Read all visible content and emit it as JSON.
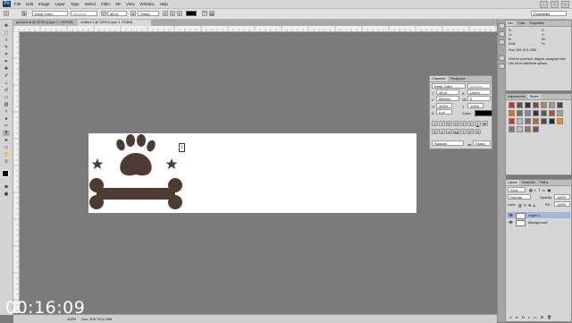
{
  "app": {
    "logo": "Ps"
  },
  "menu": [
    "File",
    "Edit",
    "Image",
    "Layer",
    "Type",
    "Select",
    "Filter",
    "3D",
    "View",
    "Window",
    "Help"
  ],
  "window_controls": [
    "–",
    "□",
    "×"
  ],
  "options": {
    "font_family": "Keep Calm",
    "font_style": "Medium",
    "font_size": "48 pt",
    "antialias": "Sharp",
    "workspace": "Essentials",
    "text_color": "#000000"
  },
  "doc_tabs": [
    {
      "label": "pet-tutor.ai @ 33.3% (Layer 1, CMYK/8)",
      "active": false
    },
    {
      "label": "Untitled-1 @ 100% (Layer 1, RGB/8)",
      "active": true
    }
  ],
  "status": {
    "zoom": "100%",
    "doc": "Doc: 905.7K/1.03M"
  },
  "info_panel": {
    "tabs": [
      "Info",
      "Color",
      "Properties"
    ],
    "lines": [
      "R:",
      "G:",
      "B:",
      "8-bit",
      "X:",
      "Y:",
      "W:",
      "H:",
      "Doc: 905.7K/1.03M"
    ],
    "hint": "Click for point text, drag for paragraph text. Use Alt for additional options."
  },
  "character_panel": {
    "tabs": [
      "Character",
      "Paragraph"
    ],
    "font": "Keep Calm",
    "style": "Medium",
    "size": "48 pt",
    "leading": "(Auto)",
    "kerning": "Metrics",
    "tracking": "0",
    "vscale": "100%",
    "hscale": "100%",
    "baseline": "0 pt",
    "color_label": "Color:",
    "language": "Spanish",
    "aa": "Sharp",
    "glyph_buttons": [
      "T",
      "T",
      "TT",
      "Tr",
      "T'",
      "T,",
      "T",
      "F"
    ]
  },
  "adjustments_panel": {
    "tabs": [
      "Adjustments",
      "Styles"
    ]
  },
  "swatch_colors": [
    "#c0392b",
    "#555555",
    "#333333",
    "#7a5230",
    "#b08a5a",
    "#9a9a9a",
    "#444444",
    "#e07030",
    "#6a6a6a",
    "#888888",
    "#333333",
    "#5a5a5a",
    "#d04030",
    "#a0a0a0",
    "#cc3333",
    "#bbbbbb",
    "#707070",
    "#d06020",
    "#4a4a4a",
    "#2a2a2a",
    "#ff8c1a",
    "#777777",
    "#c0c0c0",
    "#9a7a50",
    "#5e5e5e"
  ],
  "layers_panel": {
    "tabs": [
      "Layers",
      "Channels",
      "Paths"
    ],
    "kind": "Kind",
    "blend_mode": "Normal",
    "opacity_label": "Opacity:",
    "opacity": "100%",
    "lock_label": "Lock:",
    "fill_label": "Fill:",
    "fill": "100%",
    "layers": [
      {
        "name": "Layer 1",
        "selected": true
      },
      {
        "name": "Background",
        "selected": false
      }
    ]
  },
  "artwork": {
    "color": "#4e3b31"
  },
  "timer": "00:16:09"
}
